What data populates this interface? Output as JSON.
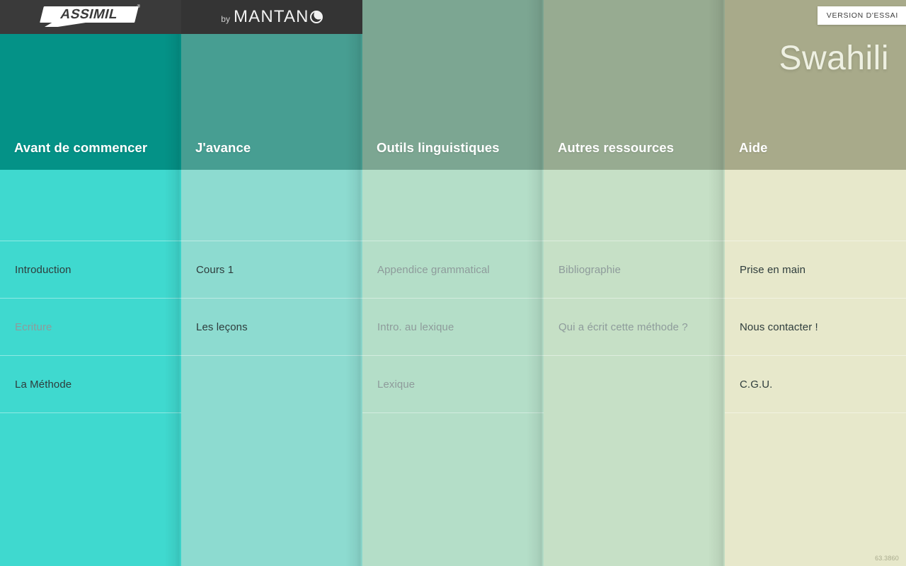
{
  "app": {
    "brand_primary": "ASSIMIL",
    "brand_secondary_prefix": "by",
    "brand_secondary": "MANTAN",
    "trial_badge": "VERSION D'ESSAI",
    "language_title": "Swahili",
    "build_version": "63.3860",
    "accent_color": "#049287",
    "topbar_color": "#3a3a3a"
  },
  "columns": [
    {
      "header": "Avant de commencer",
      "hero_color": "#049287",
      "list_color": "#3fd9cf",
      "items": [
        {
          "label": "Introduction",
          "disabled": false
        },
        {
          "label": "Ecriture",
          "disabled": true
        },
        {
          "label": "La Méthode",
          "disabled": false
        },
        {
          "label": "",
          "disabled": false
        }
      ]
    },
    {
      "header": "J'avance",
      "hero_color": "#479e92",
      "list_color": "#8ddbd0",
      "items": [
        {
          "label": "Cours 1",
          "disabled": false
        },
        {
          "label": "Les leçons",
          "disabled": false
        },
        {
          "label": "",
          "disabled": false
        }
      ]
    },
    {
      "header": "Outils linguistiques",
      "hero_color": "#7ca692",
      "list_color": "#b4dec8",
      "items": [
        {
          "label": "Appendice grammatical",
          "disabled": true
        },
        {
          "label": "Intro. au lexique",
          "disabled": true
        },
        {
          "label": "Lexique",
          "disabled": true
        },
        {
          "label": "",
          "disabled": true
        }
      ]
    },
    {
      "header": "Autres ressources",
      "hero_color": "#97ab91",
      "list_color": "#c6e0c6",
      "items": [
        {
          "label": "Bibliographie",
          "disabled": true
        },
        {
          "label": "Qui a écrit cette méthode ?",
          "disabled": true
        },
        {
          "label": "",
          "disabled": true
        }
      ]
    },
    {
      "header": "Aide",
      "hero_color": "#a8aa8a",
      "list_color": "#e7e8cb",
      "items": [
        {
          "label": "Prise en main",
          "disabled": false
        },
        {
          "label": "Nous contacter !",
          "disabled": false
        },
        {
          "label": "C.G.U.",
          "disabled": false
        },
        {
          "label": "",
          "disabled": false
        }
      ]
    }
  ]
}
